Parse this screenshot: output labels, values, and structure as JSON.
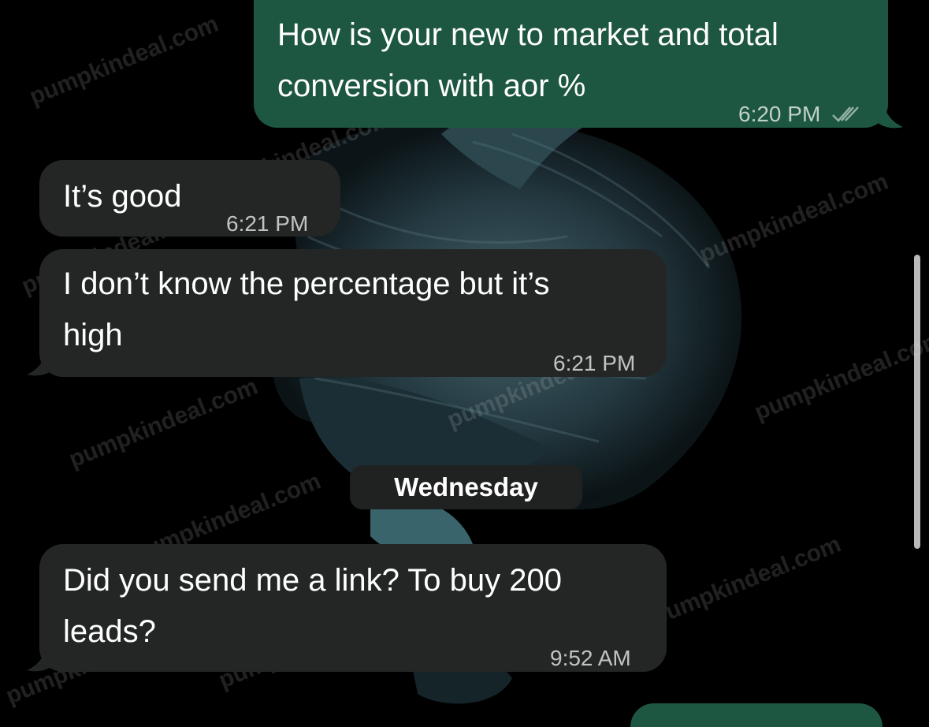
{
  "watermark_text": "pumpkindeal.com",
  "messages": [
    {
      "direction": "outgoing",
      "lines": [
        "How is your new to market and total",
        "conversion with aor %"
      ],
      "time": "6:20 PM",
      "status": "read"
    },
    {
      "direction": "incoming",
      "lines": [
        "It’s good"
      ],
      "time": "6:21 PM"
    },
    {
      "direction": "incoming",
      "lines": [
        "I don’t know the percentage but it’s",
        "high"
      ],
      "time": "6:21 PM"
    },
    {
      "direction": "incoming",
      "lines": [
        "Did you send me a link? To buy 200",
        "leads?"
      ],
      "time": "9:52 AM"
    }
  ],
  "day_separator": "Wednesday",
  "colors": {
    "outgoing_bubble": "#1d5641",
    "incoming_bubble": "#242626",
    "background": "#000000",
    "read_check": "#8fb0a3"
  }
}
